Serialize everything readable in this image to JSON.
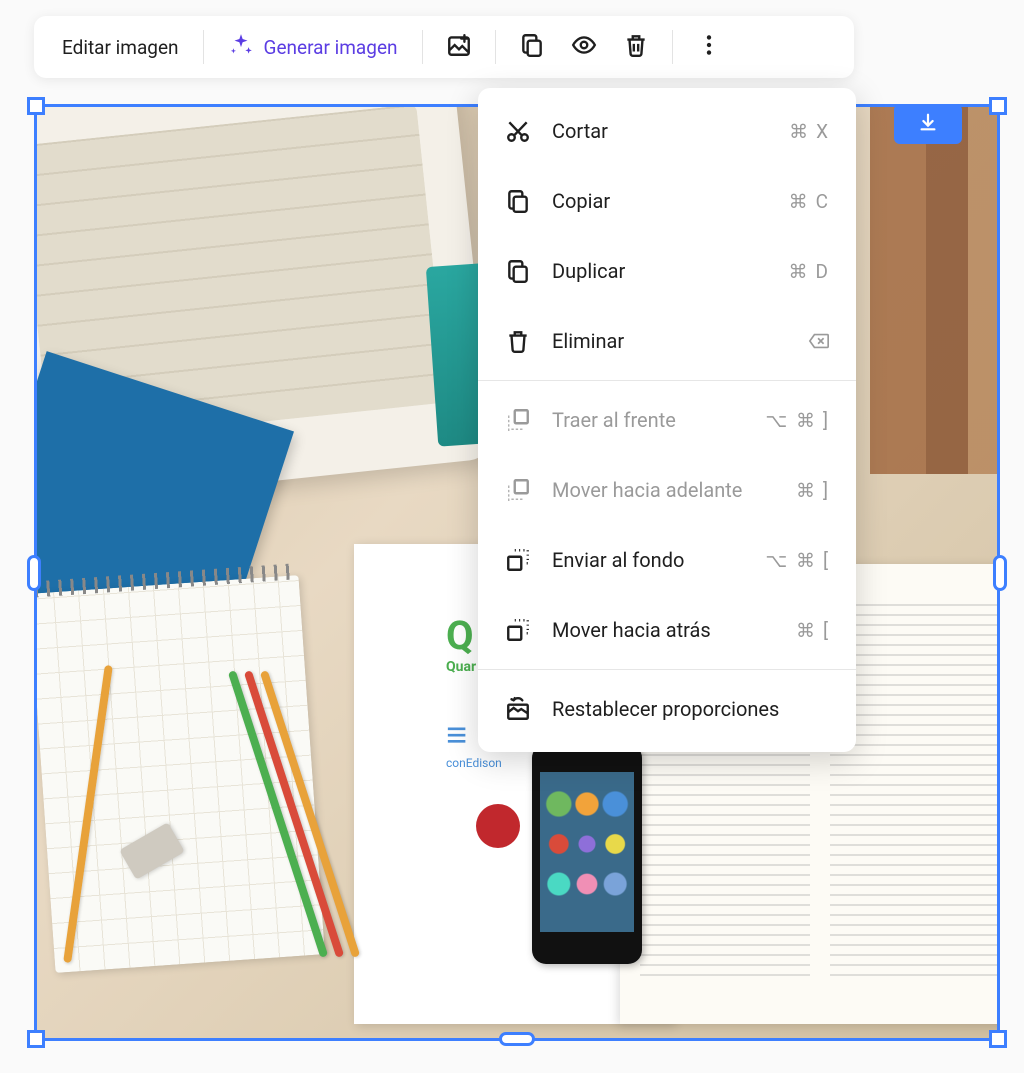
{
  "toolbar": {
    "edit_label": "Editar imagen",
    "generate_label": "Generar imagen"
  },
  "context_menu": {
    "items": [
      {
        "label": "Cortar",
        "shortcut_mod": "⌘",
        "shortcut_key": "X",
        "icon": "cut",
        "disabled": false
      },
      {
        "label": "Copiar",
        "shortcut_mod": "⌘",
        "shortcut_key": "C",
        "icon": "copy",
        "disabled": false
      },
      {
        "label": "Duplicar",
        "shortcut_mod": "⌘",
        "shortcut_key": "D",
        "icon": "duplicate",
        "disabled": false
      },
      {
        "label": "Eliminar",
        "shortcut_mod": "",
        "shortcut_key": "⌫",
        "icon": "delete",
        "disabled": false
      }
    ],
    "layer_items": [
      {
        "label": "Traer al frente",
        "shortcut_mod": "⌥ ⌘",
        "shortcut_key": "]",
        "icon": "front",
        "disabled": true
      },
      {
        "label": "Mover hacia adelante",
        "shortcut_mod": "⌘",
        "shortcut_key": "]",
        "icon": "forward",
        "disabled": true
      },
      {
        "label": "Enviar al fondo",
        "shortcut_mod": "⌥ ⌘",
        "shortcut_key": "[",
        "icon": "back",
        "disabled": false
      },
      {
        "label": "Mover hacia atrás",
        "shortcut_mod": "⌘",
        "shortcut_key": "[",
        "icon": "backward",
        "disabled": false
      }
    ],
    "reset_label": "Restablecer proporciones"
  }
}
